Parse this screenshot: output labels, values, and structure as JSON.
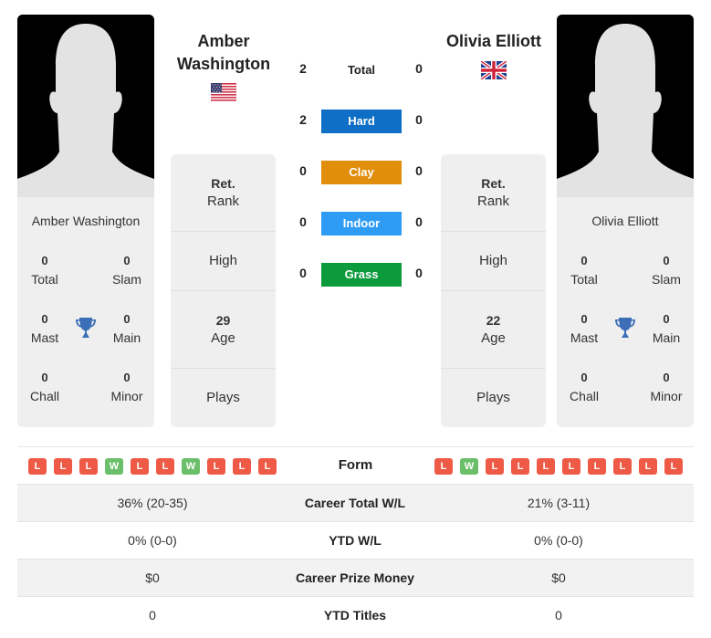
{
  "players": {
    "left": {
      "name": "Amber Washington",
      "title_line1": "Amber",
      "title_line2": "Washington",
      "flag": "us-flag",
      "stats": {
        "total": {
          "value": "0",
          "label": "Total"
        },
        "slam": {
          "value": "0",
          "label": "Slam"
        },
        "mast": {
          "value": "0",
          "label": "Mast"
        },
        "main": {
          "value": "0",
          "label": "Main"
        },
        "chall": {
          "value": "0",
          "label": "Chall"
        },
        "minor": {
          "value": "0",
          "label": "Minor"
        }
      },
      "info": {
        "rank_value": "Ret.",
        "rank_label": "Rank",
        "high_label": "High",
        "age_value": "29",
        "age_label": "Age",
        "plays_label": "Plays"
      },
      "form": [
        "L",
        "L",
        "L",
        "W",
        "L",
        "L",
        "W",
        "L",
        "L",
        "L"
      ]
    },
    "right": {
      "name": "Olivia Elliott",
      "title_line1": "Olivia Elliott",
      "flag": "uk-flag",
      "stats": {
        "total": {
          "value": "0",
          "label": "Total"
        },
        "slam": {
          "value": "0",
          "label": "Slam"
        },
        "mast": {
          "value": "0",
          "label": "Mast"
        },
        "main": {
          "value": "0",
          "label": "Main"
        },
        "chall": {
          "value": "0",
          "label": "Chall"
        },
        "minor": {
          "value": "0",
          "label": "Minor"
        }
      },
      "info": {
        "rank_value": "Ret.",
        "rank_label": "Rank",
        "high_label": "High",
        "age_value": "22",
        "age_label": "Age",
        "plays_label": "Plays"
      },
      "form": [
        "L",
        "W",
        "L",
        "L",
        "L",
        "L",
        "L",
        "L",
        "L",
        "L"
      ]
    }
  },
  "h2h": [
    {
      "label": "Total",
      "left": "2",
      "right": "0",
      "color": null
    },
    {
      "label": "Hard",
      "left": "2",
      "right": "0",
      "color": "#0f6fc6"
    },
    {
      "label": "Clay",
      "left": "0",
      "right": "0",
      "color": "#e08e0b"
    },
    {
      "label": "Indoor",
      "left": "0",
      "right": "0",
      "color": "#2e9cf5"
    },
    {
      "label": "Grass",
      "left": "0",
      "right": "0",
      "color": "#0b9a3c"
    }
  ],
  "form_label": "Form",
  "comparison": [
    {
      "label": "Career Total W/L",
      "left": "36% (20-35)",
      "right": "21% (3-11)"
    },
    {
      "label": "YTD W/L",
      "left": "0% (0-0)",
      "right": "0% (0-0)"
    },
    {
      "label": "Career Prize Money",
      "left": "$0",
      "right": "$0"
    },
    {
      "label": "YTD Titles",
      "left": "0",
      "right": "0"
    }
  ],
  "colors": {
    "loss": "#ee5a45",
    "win": "#6bbf6b",
    "trophy": "#3d6fb8"
  }
}
